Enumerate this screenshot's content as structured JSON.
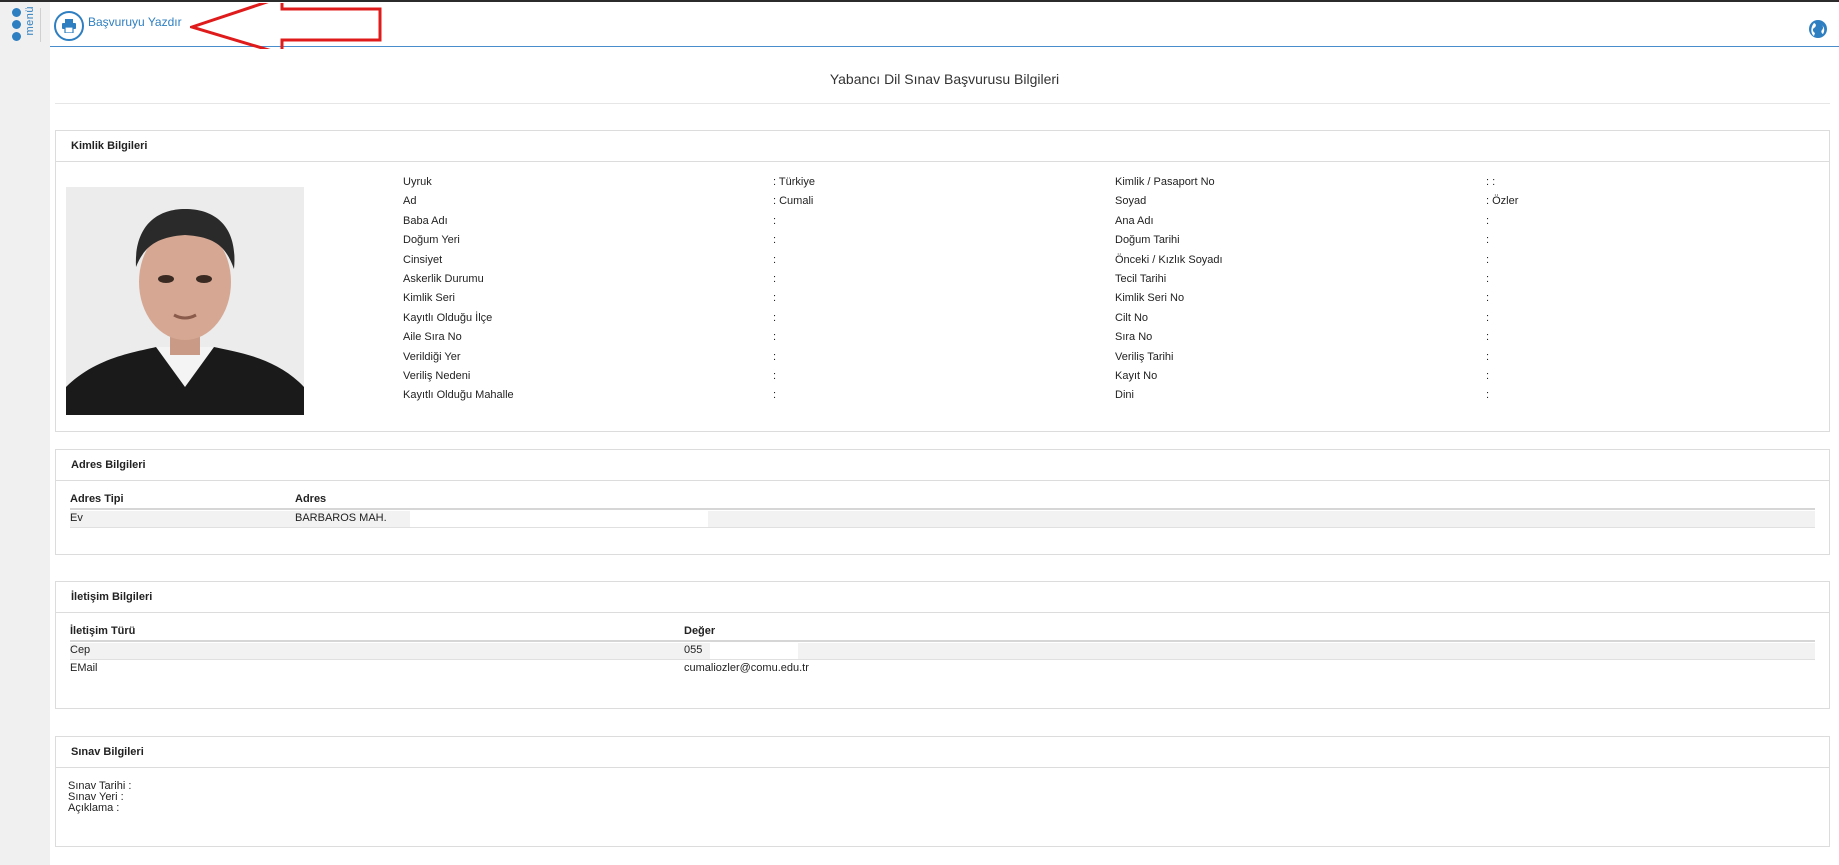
{
  "sidebar": {
    "menu_label": "menü"
  },
  "toolbar": {
    "print_label": "Başvuruyu Yazdır"
  },
  "colors": {
    "accent": "#2e7fc1",
    "arrow": "#e01b1b",
    "rail": "#f0f0f0"
  },
  "icons": {
    "print": "printer-icon",
    "globe": "globe-icon",
    "menu": "menu-dots-icon"
  },
  "page": {
    "title": "Yabancı Dil Sınav Başvurusu Bilgileri"
  },
  "identity": {
    "heading": "Kimlik Bilgileri",
    "left_labels": [
      "Uyruk",
      "Ad",
      "Baba Adı",
      "Doğum Yeri",
      "Cinsiyet",
      "Askerlik Durumu",
      "Kimlik Seri",
      "Kayıtlı Olduğu İlçe",
      "Aile Sıra No",
      "Verildiği Yer",
      "Veriliş Nedeni",
      "Kayıtlı Olduğu Mahalle"
    ],
    "left_values": [
      ":  Türkiye",
      ": Cumali",
      ":",
      ":",
      ":",
      ":",
      ":",
      ":",
      ":",
      ":",
      ":",
      ":"
    ],
    "right_labels": [
      "Kimlik / Pasaport No",
      "Soyad",
      "Ana Adı",
      "Doğum Tarihi",
      "Önceki / Kızlık Soyadı",
      "Tecil Tarihi",
      "Kimlik Seri No",
      "Cilt No",
      "Sıra No",
      "Veriliş Tarihi",
      "Kayıt No",
      "Dini"
    ],
    "right_values": [
      ": :",
      ": Özler",
      ":",
      ":",
      ":",
      ":",
      ":",
      ":",
      ":",
      ":",
      ":",
      ":"
    ]
  },
  "address": {
    "heading": "Adres Bilgileri",
    "columns": [
      "Adres Tipi",
      "Adres"
    ],
    "rows": [
      [
        "Ev",
        "BARBAROS MAH."
      ]
    ]
  },
  "contact": {
    "heading": "İletişim Bilgileri",
    "columns": [
      "İletişim Türü",
      "Değer"
    ],
    "rows": [
      [
        "Cep",
        "055"
      ],
      [
        "EMail",
        "cumaliozler@comu.edu.tr"
      ]
    ]
  },
  "exam": {
    "heading": "Sınav Bilgileri",
    "lines": [
      "Sınav Tarihi :",
      "Sınav Yeri :",
      "Açıklama :"
    ]
  }
}
